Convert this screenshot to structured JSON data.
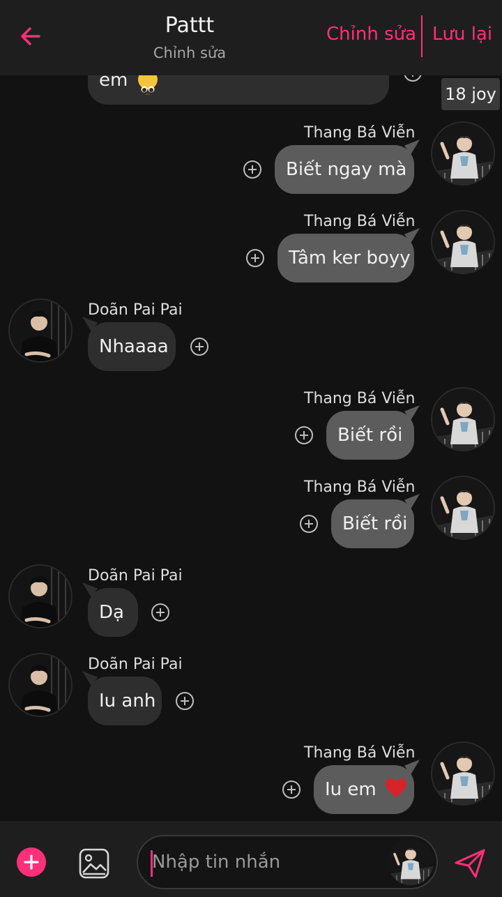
{
  "header": {
    "title": "Pattt",
    "subtitle": "Chỉnh sửa",
    "edit_label": "Chỉnh sửa",
    "save_label": "Lưu lại",
    "back_icon": "arrow-left-icon"
  },
  "partial": {
    "text": "em",
    "emoji": "pleading-face-emoji",
    "badge": "18 joy"
  },
  "messages": [
    {
      "sender": "Thang Bá Viễn",
      "text": "Biết ngay mà",
      "side": "out"
    },
    {
      "sender": "Thang Bá Viễn",
      "text": "Tâm ker boyy",
      "side": "out"
    },
    {
      "sender": "Doãn Pai Pai",
      "text": "Nhaaaa",
      "side": "in"
    },
    {
      "sender": "Thang Bá Viễn",
      "text": "Biết rồi",
      "side": "out"
    },
    {
      "sender": "Thang Bá Viễn",
      "text": "Biết rồi",
      "side": "out"
    },
    {
      "sender": "Doãn Pai Pai",
      "text": "Dạ",
      "side": "in"
    },
    {
      "sender": "Doãn Pai Pai",
      "text": "Iu anh",
      "side": "in"
    },
    {
      "sender": "Thang Bá Viễn",
      "text": "Iu em",
      "side": "out",
      "emoji": "red-heart-emoji"
    }
  ],
  "composer": {
    "placeholder": "Nhập tin nhắn",
    "plus_icon": "plus-icon",
    "image_icon": "image-icon",
    "send_icon": "send-icon"
  },
  "colors": {
    "accent": "#ff2f7a",
    "background": "#121212",
    "header_bg": "#1e1e1e",
    "incoming_bubble": "#2e2e2e",
    "outgoing_bubble": "#5c5c5c"
  }
}
